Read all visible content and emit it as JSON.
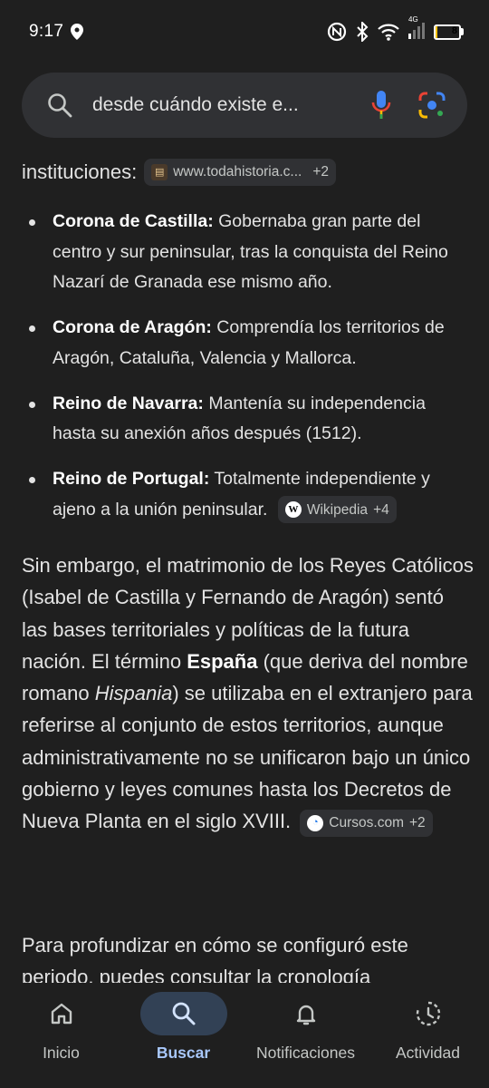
{
  "status_bar": {
    "time": "9:17",
    "network_label": "4G",
    "battery_level": 8,
    "battery_text": "8"
  },
  "search": {
    "query": "desde cuándo existe e...",
    "icons": [
      "search-icon",
      "mic-icon",
      "lens-icon"
    ]
  },
  "intro": {
    "text": "instituciones:",
    "chip_source": "www.todahistoria.c...",
    "chip_more": "+2"
  },
  "bullets": [
    {
      "title": "Corona de Castilla:",
      "text": " Gobernaba gran parte del centro y sur peninsular, tras la conquista del Reino Nazarí de Granada ese mismo año."
    },
    {
      "title": "Corona de Aragón:",
      "text": " Comprendía los territorios de Aragón, Cataluña, Valencia y Mallorca."
    },
    {
      "title": "Reino de Navarra:",
      "text": " Mantenía su independencia hasta su anexión años después (1512)."
    },
    {
      "title": "Reino de Portugal:",
      "text": " Totalmente independiente y ajeno a la unión peninsular.",
      "chip_source": "Wikipedia",
      "chip_more": "+4"
    }
  ],
  "paragraph": {
    "part1": "Sin embargo, el matrimonio de los Reyes Católicos (Isabel de Castilla y Fernando de Aragón) sentó las bases territoriales y políticas de la futura nación. El término ",
    "bold": "España",
    "part2": " (que deriva del nombre romano ",
    "italic": "Hispania",
    "part3": ") se utilizaba en el extranjero para referirse al conjunto de estos territorios, aunque administrativamente no se unificaron bajo un único gobierno y leyes comunes hasta los Decretos de Nueva Planta en el siglo XVIII.",
    "chip_source": "Cursos.com",
    "chip_more": "+2"
  },
  "paragraph2": {
    "text": "Para profundizar en cómo se configuró este periodo, puedes consultar la cronología"
  },
  "bottom_nav": [
    {
      "label": "Inicio",
      "icon": "home-icon",
      "active": false
    },
    {
      "label": "Buscar",
      "icon": "search-icon",
      "active": true
    },
    {
      "label": "Notificaciones",
      "icon": "bell-icon",
      "active": false
    },
    {
      "label": "Actividad",
      "icon": "activity-icon",
      "active": false
    }
  ],
  "colors": {
    "background": "#1f1f1f",
    "surface": "#303134",
    "text": "#e3e3e3",
    "accent": "#a8c7fa",
    "active_pill": "#324155",
    "battery": "#f3c000"
  }
}
